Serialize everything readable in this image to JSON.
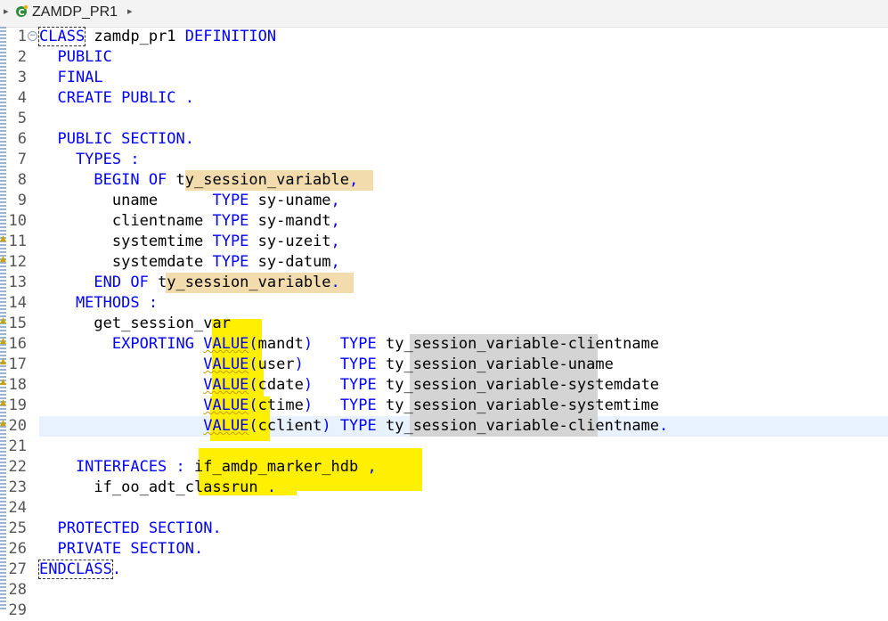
{
  "breadcrumb": {
    "class_name": "ZAMDP_PR1",
    "icon": "class-icon"
  },
  "editor": {
    "current_line": 20,
    "lines": [
      {
        "number": "1",
        "tokens": [
          {
            "text": "CLASS",
            "type": "kw",
            "boxed": true
          },
          {
            "text": " zamdp_pr1 ",
            "type": "id"
          },
          {
            "text": "DEFINITION",
            "type": "kw"
          }
        ]
      },
      {
        "number": "2",
        "tokens": [
          {
            "text": "  PUBLIC",
            "type": "kw"
          }
        ]
      },
      {
        "number": "3",
        "tokens": [
          {
            "text": "  FINAL",
            "type": "kw"
          }
        ]
      },
      {
        "number": "4",
        "tokens": [
          {
            "text": "  CREATE PUBLIC .",
            "type": "kw"
          }
        ]
      },
      {
        "number": "5",
        "tokens": []
      },
      {
        "number": "6",
        "tokens": [
          {
            "text": "  PUBLIC SECTION.",
            "type": "kw"
          }
        ]
      },
      {
        "number": "7",
        "tokens": [
          {
            "text": "    TYPES :",
            "type": "kw"
          }
        ]
      },
      {
        "number": "8",
        "tokens": [
          {
            "text": "      BEGIN OF ",
            "type": "kw"
          },
          {
            "text": "ty_session_variable",
            "type": "id"
          },
          {
            "text": ",",
            "type": "kw"
          }
        ]
      },
      {
        "number": "9",
        "tokens": [
          {
            "text": "        uname      ",
            "type": "id"
          },
          {
            "text": "TYPE ",
            "type": "kw"
          },
          {
            "text": "sy-uname",
            "type": "id"
          },
          {
            "text": ",",
            "type": "kw"
          }
        ]
      },
      {
        "number": "10",
        "tokens": [
          {
            "text": "        clientname ",
            "type": "id"
          },
          {
            "text": "TYPE ",
            "type": "kw"
          },
          {
            "text": "sy-mandt",
            "type": "id"
          },
          {
            "text": ",",
            "type": "kw"
          }
        ]
      },
      {
        "number": "11",
        "tokens": [
          {
            "text": "        systemtime ",
            "type": "id"
          },
          {
            "text": "TYPE ",
            "type": "kw"
          },
          {
            "text": "sy-uzeit",
            "type": "id"
          },
          {
            "text": ",",
            "type": "kw"
          }
        ]
      },
      {
        "number": "12",
        "tokens": [
          {
            "text": "        systemdate ",
            "type": "id"
          },
          {
            "text": "TYPE ",
            "type": "kw"
          },
          {
            "text": "sy-datum",
            "type": "id"
          },
          {
            "text": ",",
            "type": "kw"
          }
        ]
      },
      {
        "number": "13",
        "tokens": [
          {
            "text": "      END OF ",
            "type": "kw"
          },
          {
            "text": "ty_session_variable",
            "type": "id"
          },
          {
            "text": ".",
            "type": "kw"
          }
        ]
      },
      {
        "number": "14",
        "tokens": [
          {
            "text": "    METHODS :",
            "type": "kw"
          }
        ]
      },
      {
        "number": "15",
        "tokens": [
          {
            "text": "      get_session_var",
            "type": "id"
          }
        ]
      },
      {
        "number": "16",
        "tokens": [
          {
            "text": "        EXPORTING ",
            "type": "kw"
          },
          {
            "text": "VALUE",
            "type": "kw",
            "squiggle": true
          },
          {
            "text": "(",
            "type": "kw"
          },
          {
            "text": "mandt",
            "type": "id"
          },
          {
            "text": ")   ",
            "type": "kw"
          },
          {
            "text": "TYPE ",
            "type": "kw"
          },
          {
            "text": "ty_session_variable-clientname",
            "type": "id"
          }
        ]
      },
      {
        "number": "17",
        "tokens": [
          {
            "text": "                  ",
            "type": "id"
          },
          {
            "text": "VALUE",
            "type": "kw",
            "squiggle": true
          },
          {
            "text": "(",
            "type": "kw"
          },
          {
            "text": "user",
            "type": "id"
          },
          {
            "text": ")    ",
            "type": "kw"
          },
          {
            "text": "TYPE ",
            "type": "kw"
          },
          {
            "text": "ty_session_variable-uname",
            "type": "id"
          }
        ]
      },
      {
        "number": "18",
        "tokens": [
          {
            "text": "                  ",
            "type": "id"
          },
          {
            "text": "VALUE",
            "type": "kw",
            "squiggle": true
          },
          {
            "text": "(",
            "type": "kw"
          },
          {
            "text": "cdate",
            "type": "id"
          },
          {
            "text": ")   ",
            "type": "kw"
          },
          {
            "text": "TYPE ",
            "type": "kw"
          },
          {
            "text": "ty_session_variable-systemdate",
            "type": "id"
          }
        ]
      },
      {
        "number": "19",
        "tokens": [
          {
            "text": "                  ",
            "type": "id"
          },
          {
            "text": "VALUE",
            "type": "kw",
            "squiggle": true
          },
          {
            "text": "(",
            "type": "kw"
          },
          {
            "text": "ctime",
            "type": "id"
          },
          {
            "text": ")   ",
            "type": "kw"
          },
          {
            "text": "TYPE ",
            "type": "kw"
          },
          {
            "text": "ty_session_variable-systemtime",
            "type": "id"
          }
        ]
      },
      {
        "number": "20",
        "tokens": [
          {
            "text": "                  ",
            "type": "id"
          },
          {
            "text": "VALUE",
            "type": "kw",
            "squiggle": true
          },
          {
            "text": "(",
            "type": "kw"
          },
          {
            "text": "cclient",
            "type": "id"
          },
          {
            "text": ") ",
            "type": "kw"
          },
          {
            "text": "TYPE ",
            "type": "kw"
          },
          {
            "text": "ty_session_variable-clientname",
            "type": "id"
          },
          {
            "text": ".",
            "type": "kw"
          }
        ]
      },
      {
        "number": "21",
        "tokens": []
      },
      {
        "number": "22",
        "tokens": [
          {
            "text": "    INTERFACES : ",
            "type": "kw"
          },
          {
            "text": "if_amdp_marker_hdb",
            "type": "id"
          },
          {
            "text": " ,",
            "type": "kw"
          }
        ]
      },
      {
        "number": "23",
        "tokens": [
          {
            "text": "      if_oo_adt_classrun",
            "type": "id"
          },
          {
            "text": " .",
            "type": "kw"
          }
        ]
      },
      {
        "number": "24",
        "tokens": []
      },
      {
        "number": "25",
        "tokens": [
          {
            "text": "  PROTECTED SECTION.",
            "type": "kw"
          }
        ]
      },
      {
        "number": "26",
        "tokens": [
          {
            "text": "  PRIVATE SECTION.",
            "type": "kw"
          }
        ]
      },
      {
        "number": "27",
        "tokens": [
          {
            "text": "ENDCLASS",
            "type": "kw",
            "boxed": true
          },
          {
            "text": ".",
            "type": "kw"
          }
        ]
      },
      {
        "number": "28",
        "tokens": []
      },
      {
        "number": "29",
        "tokens": []
      }
    ]
  }
}
